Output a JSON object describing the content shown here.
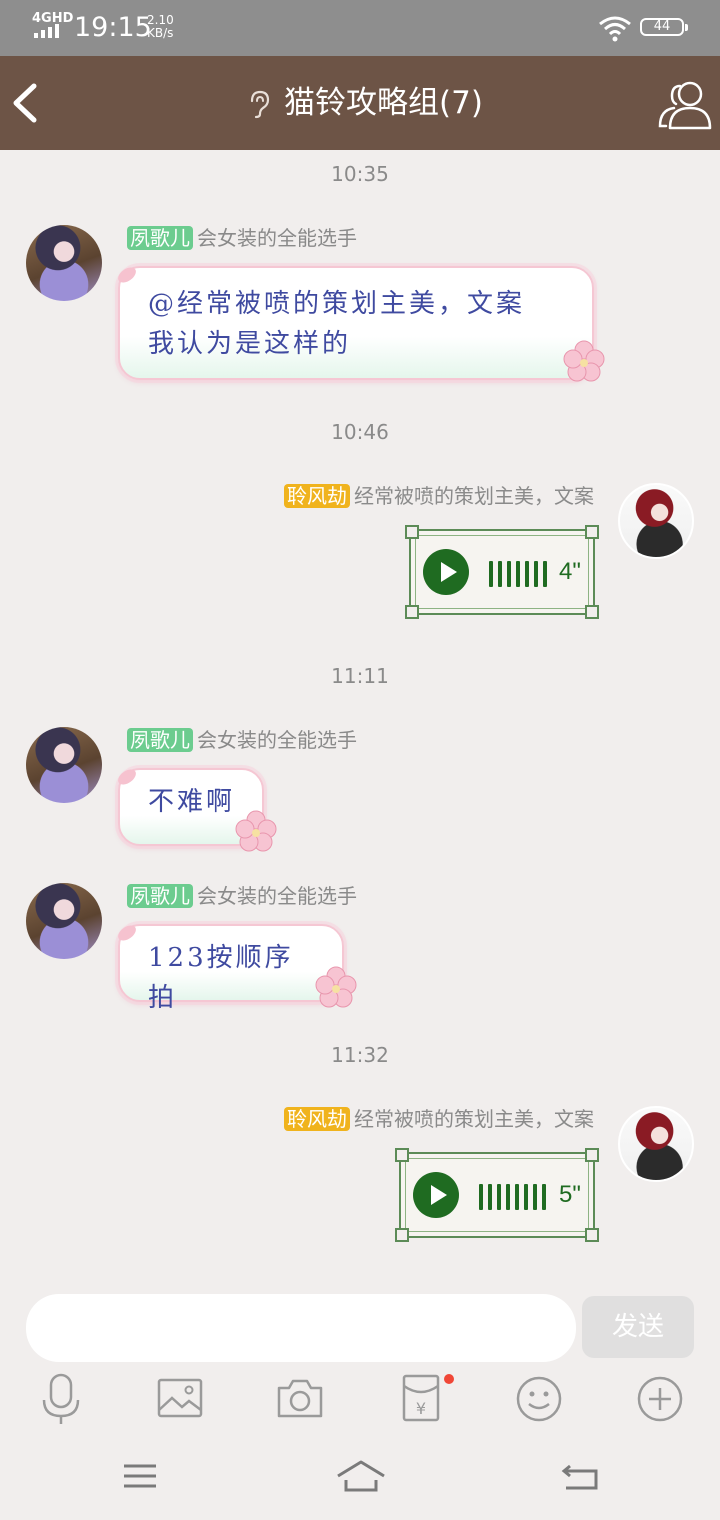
{
  "status_bar": {
    "network": "4GHD",
    "time": "19:15",
    "speed_value": "2.10",
    "speed_unit": "KB/s",
    "battery": "44"
  },
  "header": {
    "title": "猫铃攻略组(7)",
    "back_icon": "chevron-left-icon",
    "listen_icon": "ear-icon",
    "members_icon": "group-members-icon"
  },
  "messages": [
    {
      "type": "time",
      "text": "10:35"
    },
    {
      "type": "text",
      "side": "left",
      "badge": "夙歌儿",
      "title": "会女装的全能选手",
      "lines": [
        "@经常被喷的策划主美，文案",
        "我认为是这样的"
      ]
    },
    {
      "type": "time",
      "text": "10:46"
    },
    {
      "type": "voice",
      "side": "right",
      "badge": "聆风劫",
      "title": "经常被喷的策划主美，文案",
      "duration": "4\""
    },
    {
      "type": "time",
      "text": "11:11"
    },
    {
      "type": "text",
      "side": "left",
      "badge": "夙歌儿",
      "title": "会女装的全能选手",
      "lines": [
        "不难啊"
      ]
    },
    {
      "type": "text",
      "side": "left",
      "badge": "夙歌儿",
      "title": "会女装的全能选手",
      "lines": [
        "123按顺序拍"
      ]
    },
    {
      "type": "time",
      "text": "11:32"
    },
    {
      "type": "voice",
      "side": "right",
      "badge": "聆风劫",
      "title": "经常被喷的策划主美，文案",
      "duration": "5\""
    }
  ],
  "input": {
    "placeholder": "",
    "send_label": "发送"
  },
  "toolbar": {
    "icons": [
      "microphone-icon",
      "image-icon",
      "camera-icon",
      "red-packet-icon",
      "emoji-icon",
      "plus-icon"
    ],
    "badge_color": "#f04636"
  },
  "nav_bar": {
    "icons": [
      "menu-icon",
      "home-icon",
      "back-icon"
    ]
  },
  "colors": {
    "header_bg": "#6d5446",
    "status_bg": "#8e8e8e",
    "chat_bg": "#f1eeed",
    "badge_green": "#6ccc8f",
    "badge_yellow": "#f0b31d",
    "voice_green": "#1f6b21"
  }
}
